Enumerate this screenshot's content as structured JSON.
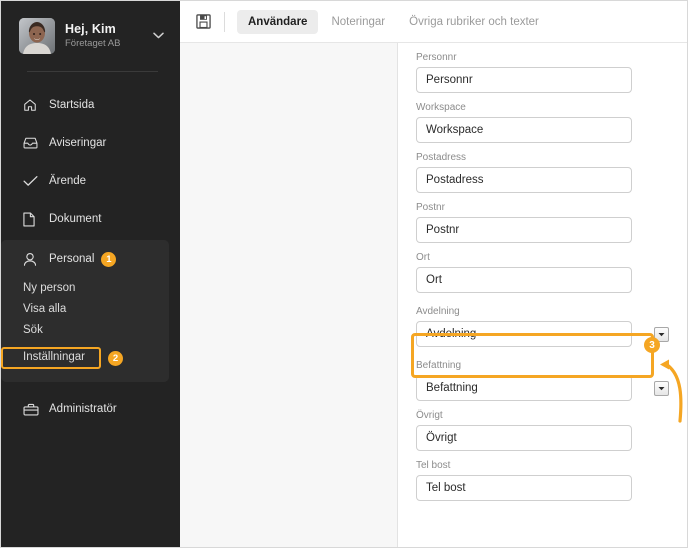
{
  "colors": {
    "sidebar_bg": "#232323",
    "submenu_bg": "#2d2d2d",
    "accent": "#f5a623",
    "left_pane_bg": "#f7f7f7",
    "tab_active_bg": "#ececec"
  },
  "sidebar": {
    "profile": {
      "name": "Hej, Kim",
      "org": "Företaget AB",
      "caret": "chevron-down-icon",
      "avatar": "user-photo"
    },
    "items": [
      {
        "label": "Startsida",
        "icon": "home-icon"
      },
      {
        "label": "Aviseringar",
        "icon": "inbox-icon"
      },
      {
        "label": "Ärende",
        "icon": "check-icon"
      },
      {
        "label": "Dokument",
        "icon": "document-icon"
      },
      {
        "label": "Personal",
        "icon": "person-icon",
        "badge": "1"
      },
      {
        "label": "Administratör",
        "icon": "toolbox-icon"
      }
    ],
    "submenu": [
      {
        "label": "Ny person"
      },
      {
        "label": "Visa alla"
      },
      {
        "label": "Sök"
      },
      {
        "label": "Inställningar",
        "highlighted": true,
        "badge": "2"
      }
    ]
  },
  "toolbar": {
    "save_icon": "save-floppy-icon",
    "tabs": [
      {
        "label": "Användare",
        "active": true
      },
      {
        "label": "Noteringar",
        "active": false
      },
      {
        "label": "Övriga rubriker och texter",
        "active": false
      }
    ]
  },
  "form": {
    "fields": [
      {
        "label": "",
        "value": "",
        "partial": true
      },
      {
        "label": "Personnr",
        "value": "Personnr"
      },
      {
        "label": "Workspace",
        "value": "Workspace"
      },
      {
        "label": "Postadress",
        "value": "Postadress"
      },
      {
        "label": "Postnr",
        "value": "Postnr"
      },
      {
        "label": "Ort",
        "value": "Ort"
      },
      {
        "label": "Avdelning",
        "value": "Avdelning",
        "dropdown": true,
        "highlighted": true
      },
      {
        "label": "Befattning",
        "value": "Befattning",
        "dropdown": true
      },
      {
        "label": "Övrigt",
        "value": "Övrigt"
      },
      {
        "label": "Tel bost",
        "value": "Tel bost"
      }
    ]
  },
  "annotations": {
    "step1": "1",
    "step2": "2",
    "step3": "3",
    "arrow": "curved-arrow-pointing-to-dropdown"
  }
}
